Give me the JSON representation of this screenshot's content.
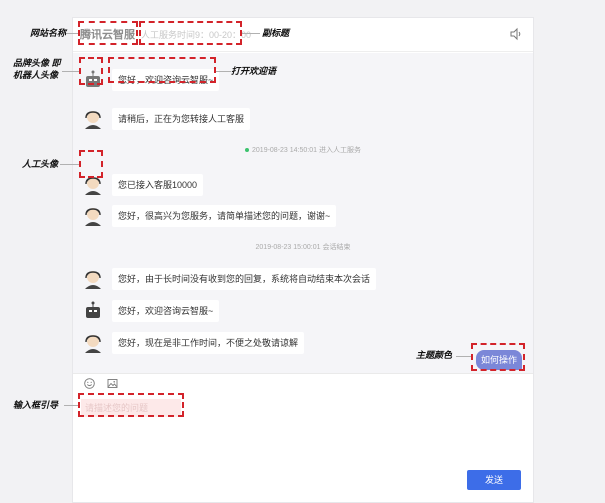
{
  "header": {
    "site_name": "腾讯云智服",
    "subtitle": "人工服务时间9：00-20：00"
  },
  "messages": {
    "m1": "您好，欢迎咨询云智服~",
    "m2": "请稍后，正在为您转接人工客服",
    "sys1": "2019-08-23 14:50:01 进入人工服务",
    "m3": "您已接入客服10000",
    "m4": "您好，很高兴为您服务，请简单描述您的问题，谢谢~",
    "sys2": "2019-08-23 15:00:01 会话结束",
    "m5": "您好，由于长时间没有收到您的回复，系统将自动结束本次会话",
    "m6": "您好，欢迎咨询云智服~",
    "m7": "您好，现在是非工作时间，不便之处敬请谅解"
  },
  "theme_button": "如何操作",
  "input_guide": "请描述您的问题",
  "send_button": "发送",
  "annotations": {
    "site_name": "网站名称",
    "subtitle": "副标题",
    "brand_avatar_line1": "品牌头像 即",
    "brand_avatar_line2": "机器人头像",
    "welcome": "打开欢迎语",
    "agent_avatar": "人工头像",
    "theme_color": "主题颜色",
    "input_guide": "输入框引导"
  },
  "colors": {
    "theme": "#7b87d8",
    "send": "#3d6de8",
    "dashed": "#d3232a"
  }
}
